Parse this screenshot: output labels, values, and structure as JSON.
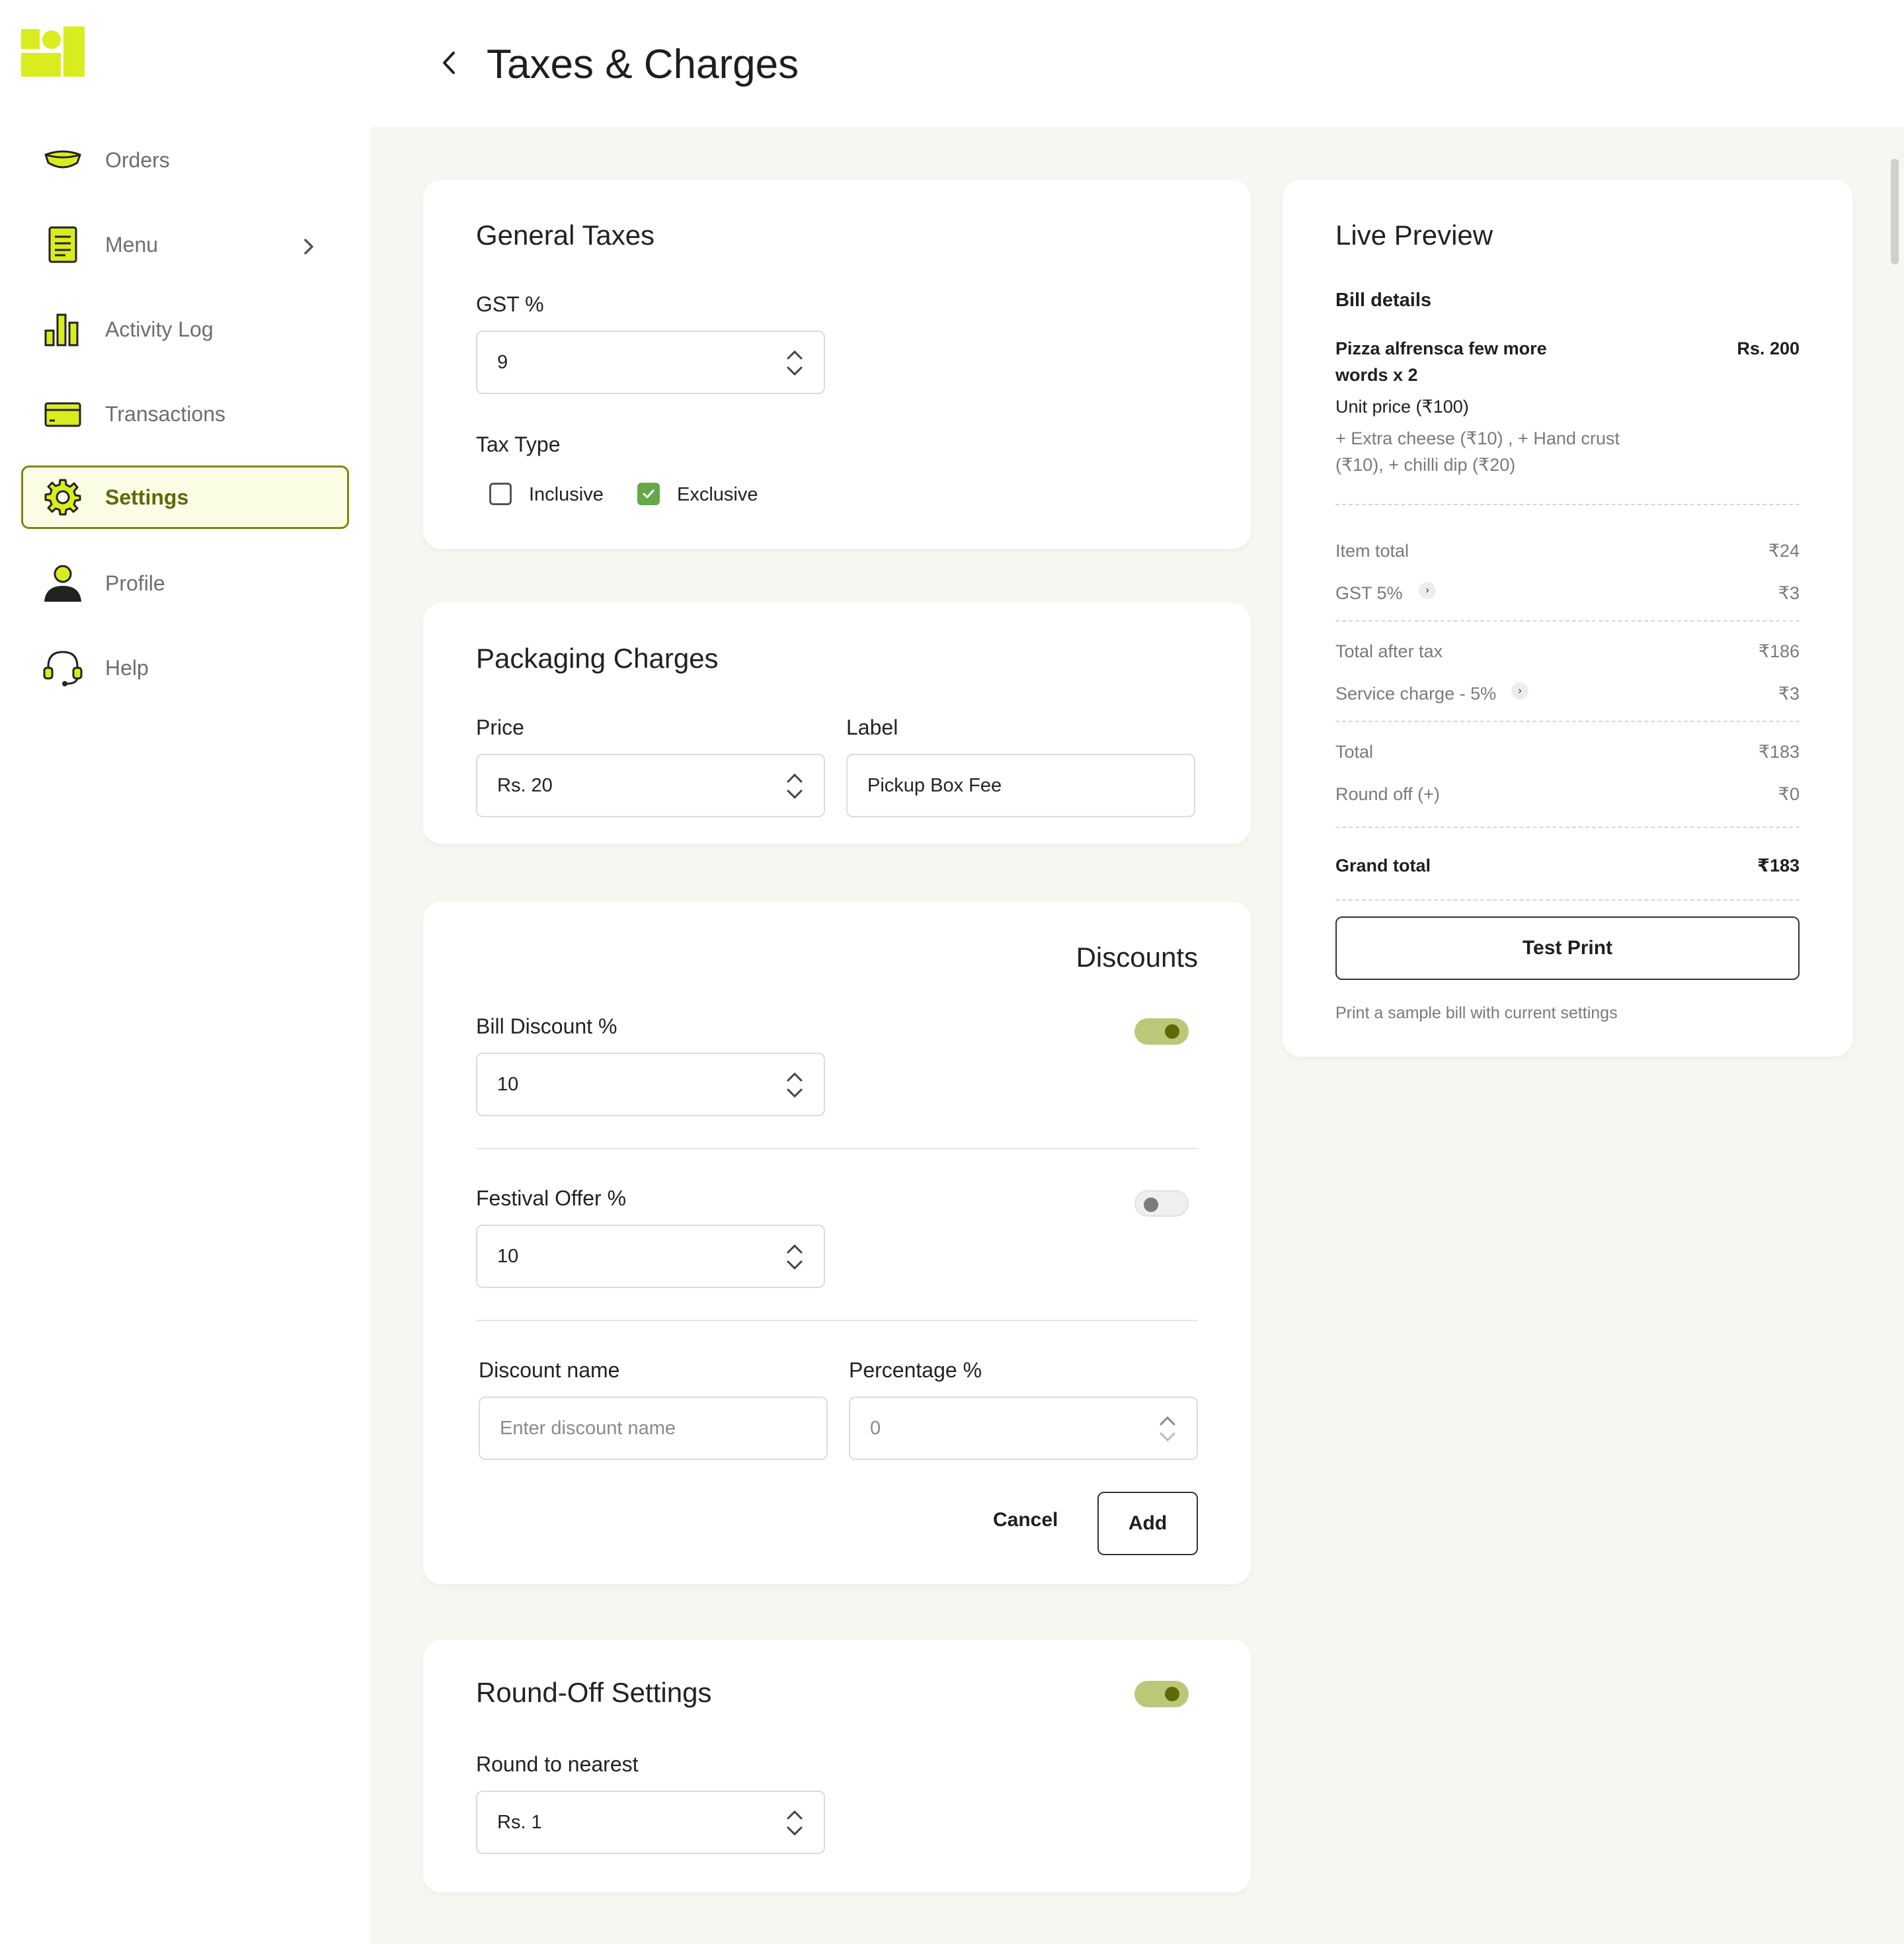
{
  "app": {
    "page_title": "Taxes & Charges"
  },
  "sidebar": {
    "items": [
      {
        "label": "Orders",
        "icon": "bowl-icon"
      },
      {
        "label": "Menu",
        "icon": "menu-list-icon"
      },
      {
        "label": "Activity Log",
        "icon": "bar-chart-icon"
      },
      {
        "label": "Transactions",
        "icon": "card-icon"
      },
      {
        "label": "Settings",
        "icon": "gear-icon",
        "active": true
      },
      {
        "label": "Profile",
        "icon": "user-icon"
      },
      {
        "label": "Help",
        "icon": "headset-icon"
      }
    ]
  },
  "general_taxes": {
    "title": "General Taxes",
    "gst_label": "GST %",
    "gst_value": "9",
    "tax_type_label": "Tax Type",
    "inclusive_label": "Inclusive",
    "inclusive_checked": false,
    "exclusive_label": "Exclusive",
    "exclusive_checked": true
  },
  "packaging": {
    "title": "Packaging Charges",
    "price_label": "Price",
    "price_value": "Rs. 20",
    "label_label": "Label",
    "label_value": "Pickup Box Fee"
  },
  "discounts": {
    "title": "Discounts",
    "bill_discount_label": "Bill Discount %",
    "bill_discount_value": "10",
    "bill_discount_enabled": true,
    "festival_label": "Festival Offer %",
    "festival_value": "10",
    "festival_enabled": false,
    "name_label": "Discount name",
    "name_placeholder": "Enter discount name",
    "percentage_label": "Percentage %",
    "percentage_placeholder": "0",
    "cancel_label": "Cancel",
    "add_label": "Add"
  },
  "round_off": {
    "title": "Round-Off Settings",
    "enabled": true,
    "nearest_label": "Round to nearest",
    "nearest_value": "Rs. 1"
  },
  "preview": {
    "title": "Live Preview",
    "bill_details": "Bill details",
    "item_name_line1": "Pizza alfrensca few more",
    "item_name_line2": "words x 2",
    "item_price": "Rs. 200",
    "unit_price": "Unit price (₹100)",
    "addons_line1": "+ Extra cheese (₹10) , + Hand crust",
    "addons_line2": "(₹10), + chilli dip (₹20)",
    "item_total_label": "Item total",
    "item_total_value": "₹24",
    "gst_label": "GST 5%",
    "gst_value": "₹3",
    "after_tax_label": "Total after tax",
    "after_tax_value": "₹186",
    "service_label": "Service charge - 5%",
    "service_value": "₹3",
    "total_label": "Total",
    "total_value": "₹183",
    "round_label": "Round off (+)",
    "round_value": "₹0",
    "grand_label": "Grand total",
    "grand_value": "₹183",
    "test_print_label": "Test Print",
    "test_print_hint": "Print a sample bill with current settings"
  },
  "colors": {
    "accent": "#d9ec1f",
    "accent_dark": "#5d6a07",
    "check_green": "#66a847"
  }
}
